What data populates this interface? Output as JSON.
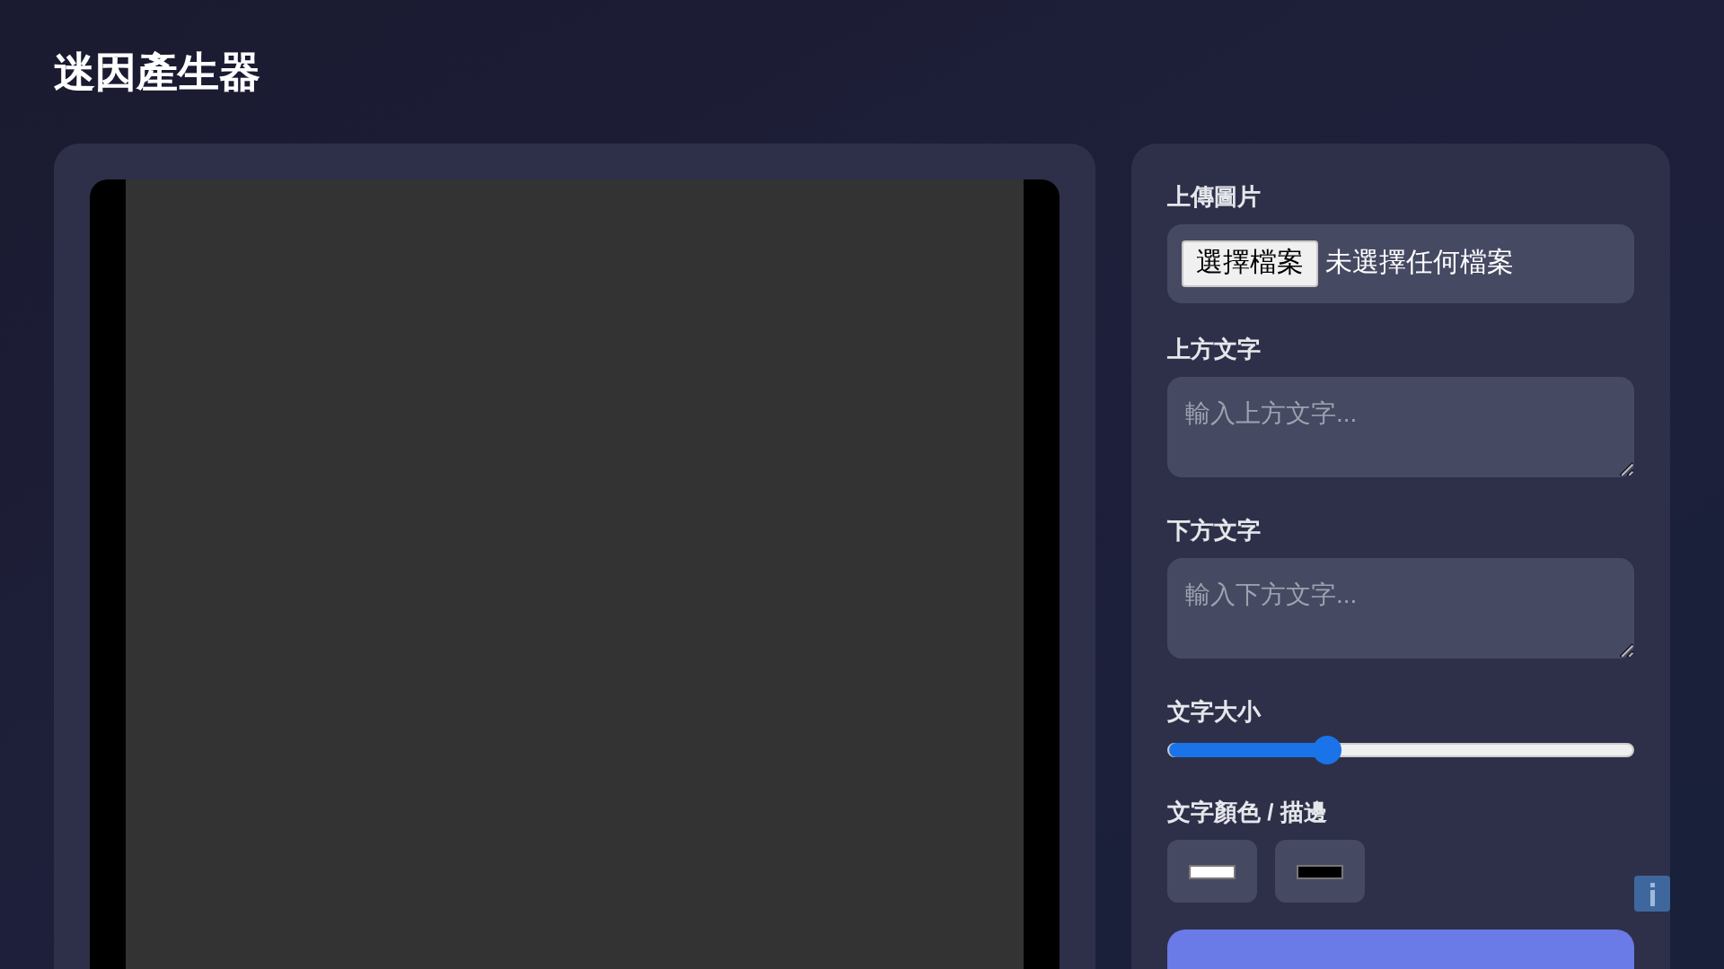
{
  "title": "迷因產生器",
  "upload": {
    "label": "上傳圖片",
    "button": "選擇檔案",
    "status": "未選擇任何檔案"
  },
  "top_text": {
    "label": "上方文字",
    "placeholder": "輸入上方文字..."
  },
  "bottom_text": {
    "label": "下方文字",
    "placeholder": "輸入下方文字..."
  },
  "font_size": {
    "label": "文字大小",
    "level": 0.34
  },
  "colors": {
    "label": "文字顏色 / 描邊",
    "swatches": [
      {
        "color": "#ffffff"
      },
      {
        "color": "#000000"
      }
    ]
  }
}
